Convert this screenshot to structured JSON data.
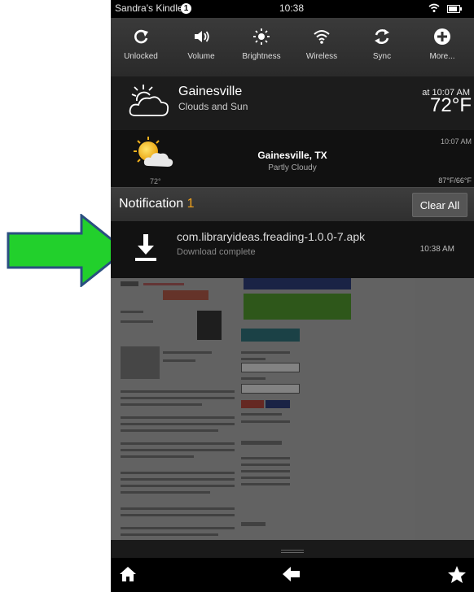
{
  "status_bar": {
    "device_name": "Sandra's Kindle",
    "notification_badge": "1",
    "time": "10:38",
    "wifi_icon": "wifi-icon",
    "battery_icon": "battery-icon"
  },
  "quick_settings": [
    {
      "label": "Unlocked",
      "icon": "rotation-lock-icon"
    },
    {
      "label": "Volume",
      "icon": "volume-icon"
    },
    {
      "label": "Brightness",
      "icon": "brightness-icon"
    },
    {
      "label": "Wireless",
      "icon": "wireless-icon"
    },
    {
      "label": "Sync",
      "icon": "sync-icon"
    },
    {
      "label": "More...",
      "icon": "plus-icon"
    }
  ],
  "weather_primary": {
    "city": "Gainesville",
    "condition": "Clouds and Sun",
    "as_of": "at 10:07 AM",
    "temperature": "72°F"
  },
  "weather_secondary": {
    "temperature_small": "72°",
    "city": "Gainesville, TX",
    "condition": "Partly Cloudy",
    "time": "10:07 AM",
    "high_low": "87°F/66°F"
  },
  "notifications": {
    "title": "Notification",
    "count": "1",
    "clear_all_label": "Clear All",
    "items": [
      {
        "name": "com.libraryideas.freading-1.0.0-7.apk",
        "status": "Download complete",
        "time": "10:38 AM",
        "icon": "download-icon"
      }
    ]
  },
  "nav_bar": {
    "home_icon": "home-icon",
    "back_icon": "back-arrow-icon",
    "favorites_icon": "star-icon"
  },
  "colors": {
    "accent_count": "#f2a31c",
    "arrow_fill": "#22d02c",
    "arrow_stroke": "#2a4f80"
  }
}
